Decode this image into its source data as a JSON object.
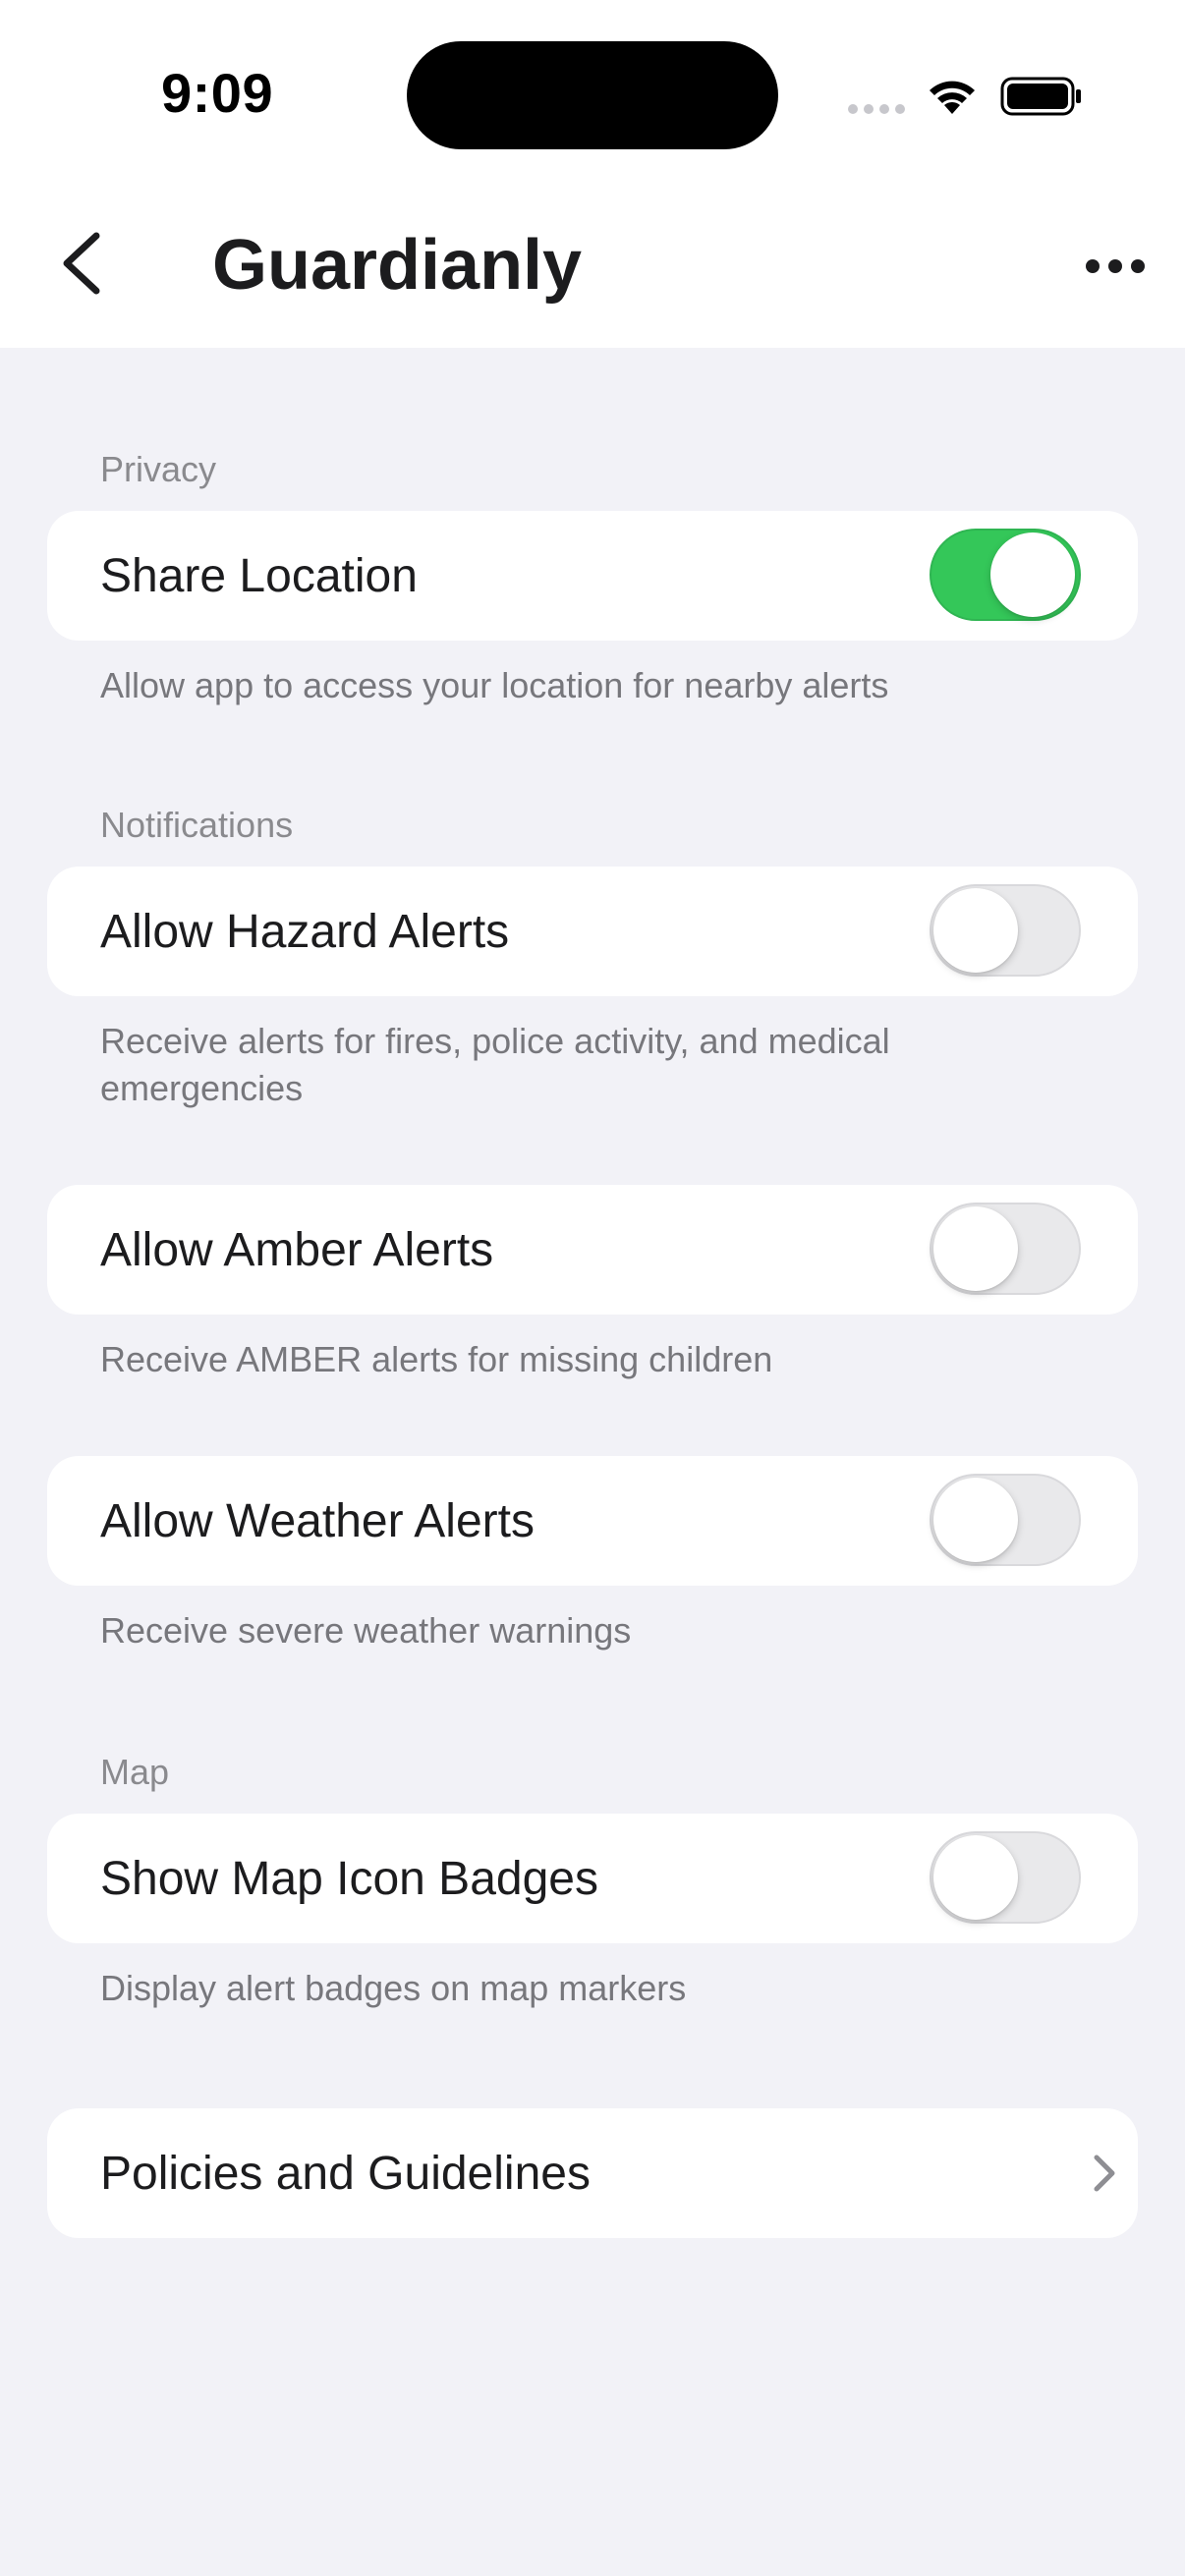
{
  "status_bar": {
    "time": "9:09"
  },
  "nav": {
    "title": "Guardianly"
  },
  "sections": {
    "privacy": {
      "header": "Privacy",
      "share_location": {
        "label": "Share Location",
        "enabled": true,
        "footer": "Allow app to access your location for nearby alerts"
      }
    },
    "notifications": {
      "header": "Notifications",
      "hazard": {
        "label": "Allow Hazard Alerts",
        "enabled": false,
        "footer_line1": "Receive alerts for fires, police activity, and medical",
        "footer_line2": "emergencies"
      },
      "amber": {
        "label": "Allow Amber Alerts",
        "enabled": false,
        "footer": "Receive AMBER alerts for missing children"
      },
      "weather": {
        "label": "Allow Weather Alerts",
        "enabled": false,
        "footer": "Receive severe weather warnings"
      }
    },
    "map": {
      "header": "Map",
      "badges": {
        "label": "Show Map Icon Badges",
        "enabled": false,
        "footer": "Display alert badges on map markers"
      }
    },
    "policies": {
      "label": "Policies and Guidelines"
    }
  },
  "colors": {
    "background": "#F2F2F7",
    "toggle_on": "#34C759",
    "toggle_off": "#E9E9EB"
  },
  "icons": {
    "back": "chevron-left-icon",
    "more": "ellipsis-icon",
    "signal": "cellular-signal-icon",
    "wifi": "wifi-icon",
    "battery": "battery-icon",
    "disclosure": "chevron-right-icon"
  }
}
